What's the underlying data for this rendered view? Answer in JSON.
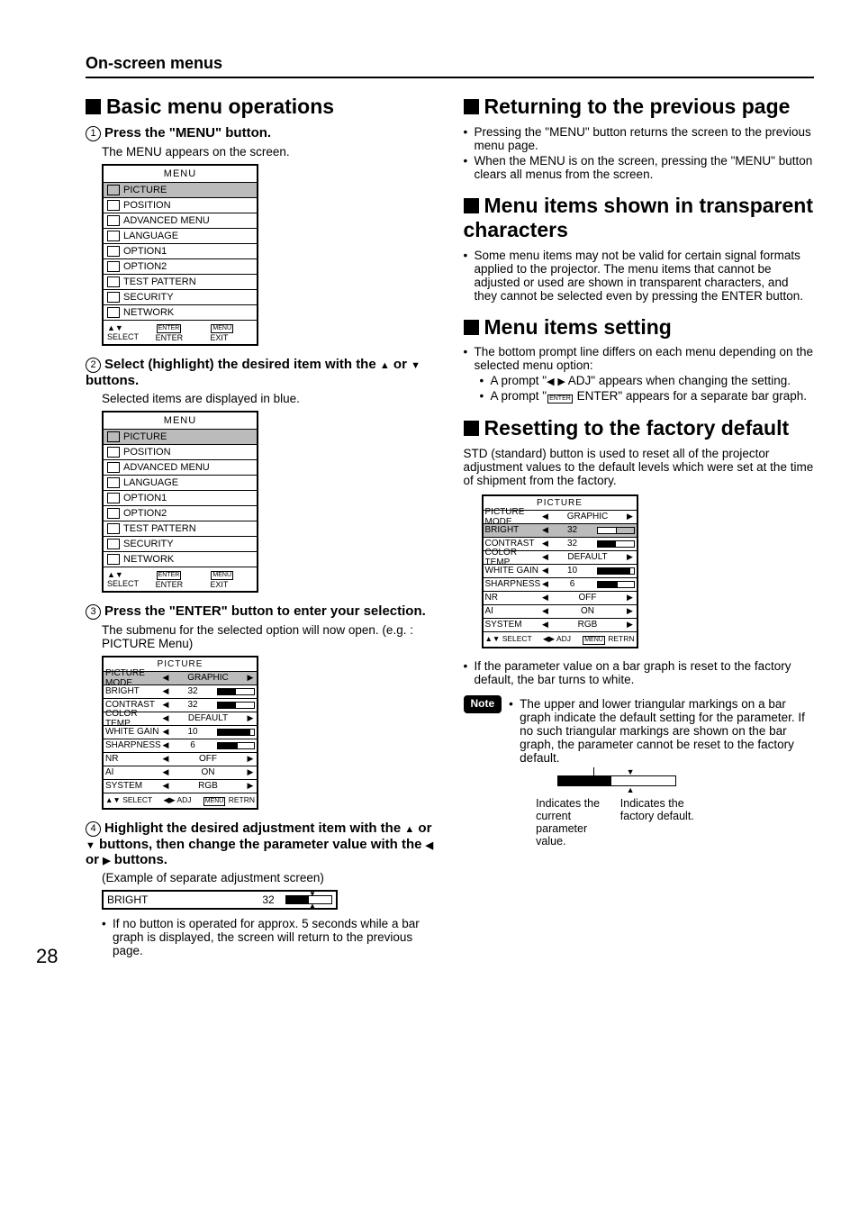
{
  "header": "On-screen menus",
  "page_number": "28",
  "left": {
    "title": "Basic menu operations",
    "steps": [
      {
        "num": "1",
        "head": "Press the \"MENU\" button.",
        "desc": "The MENU appears on the screen."
      },
      {
        "num": "2",
        "head_parts": [
          "Select (highlight) the desired item with the ",
          " or ",
          " buttons."
        ],
        "desc": "Selected items are displayed in blue."
      },
      {
        "num": "3",
        "head": "Press the \"ENTER\" button to enter your selection.",
        "desc": "The submenu for the selected option will now open. (e.g. : PICTURE Menu)"
      },
      {
        "num": "4",
        "head_parts": [
          "Highlight the desired adjustment item with the ",
          " or ",
          " buttons, then change the parameter value with the ",
          " or ",
          " buttons."
        ],
        "desc": "(Example of separate adjustment screen)"
      }
    ],
    "menu": {
      "title": "MENU",
      "items": [
        "PICTURE",
        "POSITION",
        "ADVANCED MENU",
        "LANGUAGE",
        "OPTION1",
        "OPTION2",
        "TEST PATTERN",
        "SECURITY",
        "NETWORK"
      ],
      "footer": {
        "select": "SELECT",
        "enter": "ENTER",
        "exit": "EXIT",
        "enter_key": "ENTER",
        "menu_key": "MENU"
      }
    },
    "picture": {
      "title": "PICTURE",
      "rows": [
        {
          "label": "PICTURE MODE",
          "value": "GRAPHIC",
          "type": "opt",
          "highlight": true
        },
        {
          "label": "BRIGHT",
          "value": "32",
          "type": "bar",
          "fill": 50
        },
        {
          "label": "CONTRAST",
          "value": "32",
          "type": "bar",
          "fill": 50
        },
        {
          "label": "COLOR TEMP.",
          "value": "DEFAULT",
          "type": "opt"
        },
        {
          "label": "WHITE GAIN",
          "value": "10",
          "type": "bar",
          "fill": 90
        },
        {
          "label": "SHARPNESS",
          "value": "6",
          "type": "bar",
          "fill": 55
        },
        {
          "label": "NR",
          "value": "OFF",
          "type": "opt"
        },
        {
          "label": "AI",
          "value": "ON",
          "type": "opt"
        },
        {
          "label": "SYSTEM",
          "value": "RGB",
          "type": "opt"
        }
      ],
      "footer": {
        "select": "SELECT",
        "adj": "ADJ",
        "retrn": "RETRN",
        "menu_key": "MENU"
      }
    },
    "adjust": {
      "label": "BRIGHT",
      "value": "32"
    },
    "tail_note": "If no button is operated for approx. 5 seconds while a bar graph is displayed, the screen will return to the previous page."
  },
  "right": {
    "sec1": {
      "title": "Returning to the previous page",
      "bullets": [
        "Pressing the \"MENU\" button returns the screen to the previous menu page.",
        "When the MENU is on the screen, pressing the \"MENU\" button clears all menus from the screen."
      ]
    },
    "sec2": {
      "title": "Menu items shown in transparent characters",
      "bullets": [
        "Some menu items may not be valid for certain signal formats applied to the projector. The menu items that cannot be adjusted or used are shown in transparent characters, and they cannot be selected even by pressing the ENTER button."
      ]
    },
    "sec3": {
      "title": "Menu items setting",
      "bullets": [
        "The bottom prompt line differs on each menu depending on the selected menu option:"
      ],
      "subs": [
        {
          "pre": "A prompt \"",
          "mid": " ADJ\" appears when changing the setting."
        },
        {
          "pre": "A prompt \"",
          "key": "ENTER",
          "post": " ENTER\" appears for a separate bar graph."
        }
      ]
    },
    "sec4": {
      "title": "Resetting to the factory default",
      "para": "STD (standard) button is used to reset all of the projector adjustment values to the default levels which were set at the time of shipment from the factory.",
      "bullet_after": "If the parameter value on a bar graph is reset to the factory default, the bar turns to white.",
      "note_label": "Note",
      "note": "The upper and lower triangular markings on a bar graph indicate the default setting for the parameter. If no such triangular markings are shown on the bar graph, the parameter cannot be reset to the factory default.",
      "ind_current": "Indicates the current parameter value.",
      "ind_default": "Indicates the factory default."
    },
    "picture2": {
      "title": "PICTURE",
      "rows": [
        {
          "label": "PICTURE MODE",
          "value": "GRAPHIC",
          "type": "opt"
        },
        {
          "label": "BRIGHT",
          "value": "32",
          "type": "bar",
          "fill": 50,
          "highlight": true,
          "white": true
        },
        {
          "label": "CONTRAST",
          "value": "32",
          "type": "bar",
          "fill": 50
        },
        {
          "label": "COLOR TEMP.",
          "value": "DEFAULT",
          "type": "opt"
        },
        {
          "label": "WHITE GAIN",
          "value": "10",
          "type": "bar",
          "fill": 90
        },
        {
          "label": "SHARPNESS",
          "value": "6",
          "type": "bar",
          "fill": 55
        },
        {
          "label": "NR",
          "value": "OFF",
          "type": "opt"
        },
        {
          "label": "AI",
          "value": "ON",
          "type": "opt"
        },
        {
          "label": "SYSTEM",
          "value": "RGB",
          "type": "opt"
        }
      ],
      "footer": {
        "select": "SELECT",
        "adj": "ADJ",
        "retrn": "RETRN",
        "menu_key": "MENU"
      }
    }
  }
}
